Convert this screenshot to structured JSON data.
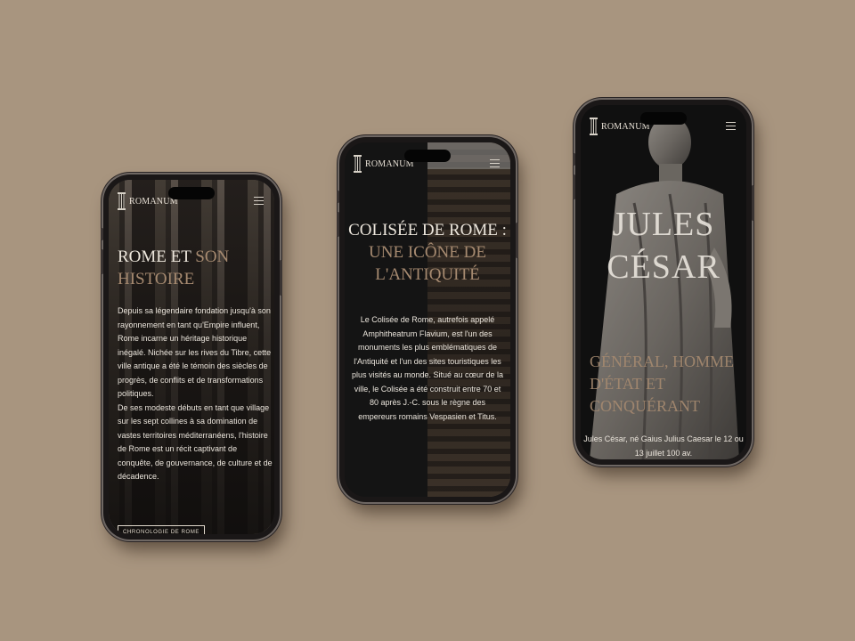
{
  "brand": "ROMANUM",
  "colors": {
    "background": "#a8957f",
    "accent": "#a68a70",
    "text": "#ece6dc",
    "dark": "#141313"
  },
  "phone1": {
    "heading_main": "ROME ET ",
    "heading_accent": "SON HISTOIRE",
    "body": "Depuis sa légendaire fondation jusqu'à son rayonnement en tant qu'Empire influent, Rome incarne un héritage historique inégalé. Nichée sur les rives du Tibre, cette ville antique a été le témoin des siècles de progrès, de conflits et de transformations politiques.\nDe ses modeste débuts en tant que village sur les sept collines à sa domination de vastes territoires méditerranéens, l'histoire de Rome est un récit captivant de conquête, de gouvernance, de culture et de décadence.",
    "cta": "CHRONOLOGIE DE ROME"
  },
  "phone2": {
    "heading_main": "COLISÉE DE ROME : ",
    "heading_accent": "UNE ICÔNE DE L'ANTIQUITÉ",
    "body": "Le Colisée de Rome, autrefois appelé Amphitheatrum Flavium, est l'un des monuments les plus emblématiques de l'Antiquité et l'un des sites touristiques les plus visités au monde. Situé au cœur de la ville, le Colisée a été construit entre 70 et 80 après J.-C. sous le règne des empereurs romains Vespasien et Titus."
  },
  "phone3": {
    "heading": "JULES CÉSAR",
    "subheading": "GÉNÉRAL, HOMME D'ÉTAT ET CONQUÉRANT",
    "body": "Jules César, né Gaius Julius Caesar le 12 ou 13 juillet 100 av."
  },
  "icons": {
    "logo": "column-icon",
    "menu": "hamburger-menu-icon"
  }
}
